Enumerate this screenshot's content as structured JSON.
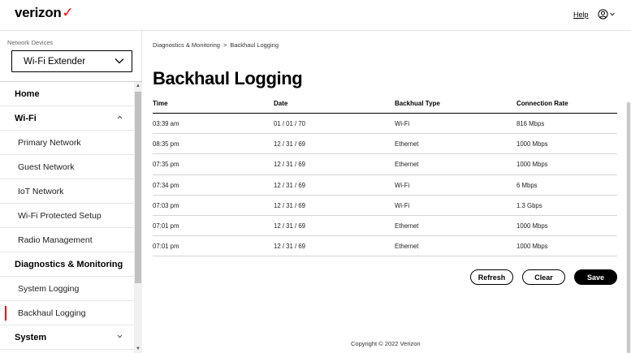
{
  "header": {
    "logo": "verizon",
    "logo_mark": "✓",
    "help_label": "Help"
  },
  "sidebar": {
    "network_devices_label": "Network Devices",
    "device_selected": "Wi-Fi Extender",
    "items": [
      {
        "label": "Home",
        "kind": "top"
      },
      {
        "label": "Wi-Fi",
        "kind": "top",
        "caret": "up"
      },
      {
        "label": "Primary Network",
        "kind": "sub"
      },
      {
        "label": "Guest Network",
        "kind": "sub"
      },
      {
        "label": "IoT Network",
        "kind": "sub"
      },
      {
        "label": "Wi-Fi Protected Setup",
        "kind": "sub"
      },
      {
        "label": "Radio Management",
        "kind": "sub"
      },
      {
        "label": "Diagnostics & Monitoring",
        "kind": "top",
        "caret": "up"
      },
      {
        "label": "System Logging",
        "kind": "sub"
      },
      {
        "label": "Backhaul Logging",
        "kind": "sub",
        "active": true
      },
      {
        "label": "System",
        "kind": "top",
        "caret": "down"
      }
    ]
  },
  "breadcrumb": {
    "parent": "Diagnostics & Monitoring",
    "separator": ">",
    "current": "Backhaul Logging"
  },
  "page": {
    "title": "Backhaul Logging"
  },
  "table": {
    "headers": [
      "Time",
      "Date",
      "Backhual Type",
      "Connection Rate"
    ],
    "rows": [
      [
        "03:39 am",
        "01 / 01 / 70",
        "Wi-Fi",
        "816 Mbps"
      ],
      [
        "08:35 pm",
        "12 / 31 / 69",
        "Ethernet",
        "1000 Mbps"
      ],
      [
        "07:35 pm",
        "12 / 31 / 69",
        "Ethernet",
        "1000 Mbps"
      ],
      [
        "07:34 pm",
        "12 / 31 / 69",
        "Wi-Fi",
        "6 Mbps"
      ],
      [
        "07:03 pm",
        "12 / 31 / 69",
        "Wi-Fi",
        "1.3 Gbps"
      ],
      [
        "07:01 pm",
        "12 / 31 / 69",
        "Ethernet",
        "1000 Mbps"
      ],
      [
        "07:01 pm",
        "12 / 31 / 69",
        "Ethernet",
        "1000 Mbps"
      ]
    ]
  },
  "actions": {
    "refresh_label": "Refresh",
    "clear_label": "Clear",
    "save_label": "Save"
  },
  "footer": {
    "copyright": "Copyright © 2022 Verizon"
  },
  "colors": {
    "brand_red": "#ee0000",
    "primary_black": "#000000"
  }
}
